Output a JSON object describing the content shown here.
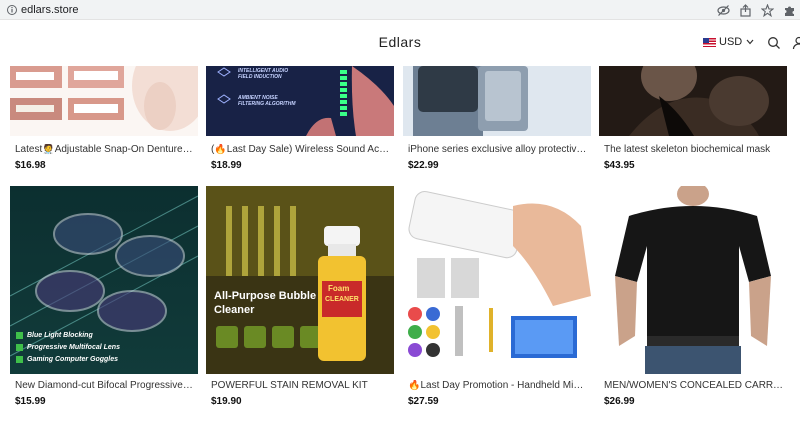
{
  "browser": {
    "url": "edlars.store"
  },
  "header": {
    "brand": "Edlars",
    "currency": "USD"
  },
  "products": [
    {
      "title": "Latest🧑‍⚕️Adjustable Snap-On Dentures😁",
      "price": "$16.98"
    },
    {
      "title": "(🔥Last Day Sale) Wireless Sound Activ...",
      "price": "$18.99",
      "image_text": [
        "INTELLIGENT AUDIO FIELD INDUCTION",
        "AMBIENT NOISE FILTERING ALGORITHM"
      ]
    },
    {
      "title": "iPhone series exclusive alloy protective c...",
      "price": "$22.99"
    },
    {
      "title": "The latest skeleton biochemical mask",
      "price": "$43.95"
    },
    {
      "title": "New Diamond-cut Bifocal Progressive A...",
      "price": "$15.99",
      "image_text": [
        "Blue Light Blocking",
        "Progressive Multifocal Lens",
        "Gaming Computer Goggles"
      ]
    },
    {
      "title": "POWERFUL STAIN REMOVAL KIT",
      "price": "$19.90",
      "image_text": [
        "All-Purpose Bubble",
        "Cleaner",
        "Foam",
        "CLEANER"
      ]
    },
    {
      "title": "🔥Last Day Promotion - Handheld Mini ...",
      "price": "$27.59"
    },
    {
      "title": "MEN/WOMEN'S CONCEALED CARRY T-...",
      "price": "$26.99"
    }
  ],
  "colors": {
    "header_bg": "#ffffff",
    "address_bar_bg": "#f1f3f4",
    "text": "#333333"
  }
}
